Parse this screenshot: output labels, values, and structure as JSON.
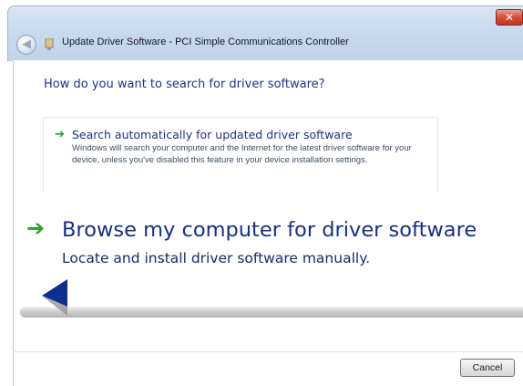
{
  "window": {
    "title": "Update Driver Software - PCI Simple Communications Controller",
    "close_glyph": "✕",
    "back_glyph": "◀"
  },
  "main": {
    "heading": "How do you want to search for driver software?",
    "option_auto": {
      "arrow_glyph": "➔",
      "title": "Search automatically for updated driver software",
      "description": "Windows will search your computer and the Internet for the latest driver software for your device, unless you've disabled this feature in your device installation settings."
    },
    "option_browse": {
      "arrow_glyph": "➔",
      "title": "Browse my computer for driver software",
      "description": "Locate and install driver software manually."
    }
  },
  "footer": {
    "cancel_label": "Cancel"
  },
  "icons": {
    "back": "back-arrow-icon",
    "device": "device-icon",
    "arrow": "green-arrow-icon",
    "cursor": "mouse-pointer-icon"
  },
  "colors": {
    "heading": "#1e3287",
    "arrow": "#2ea02c",
    "close": "#c2361f",
    "titlebar": "#c8daee"
  }
}
